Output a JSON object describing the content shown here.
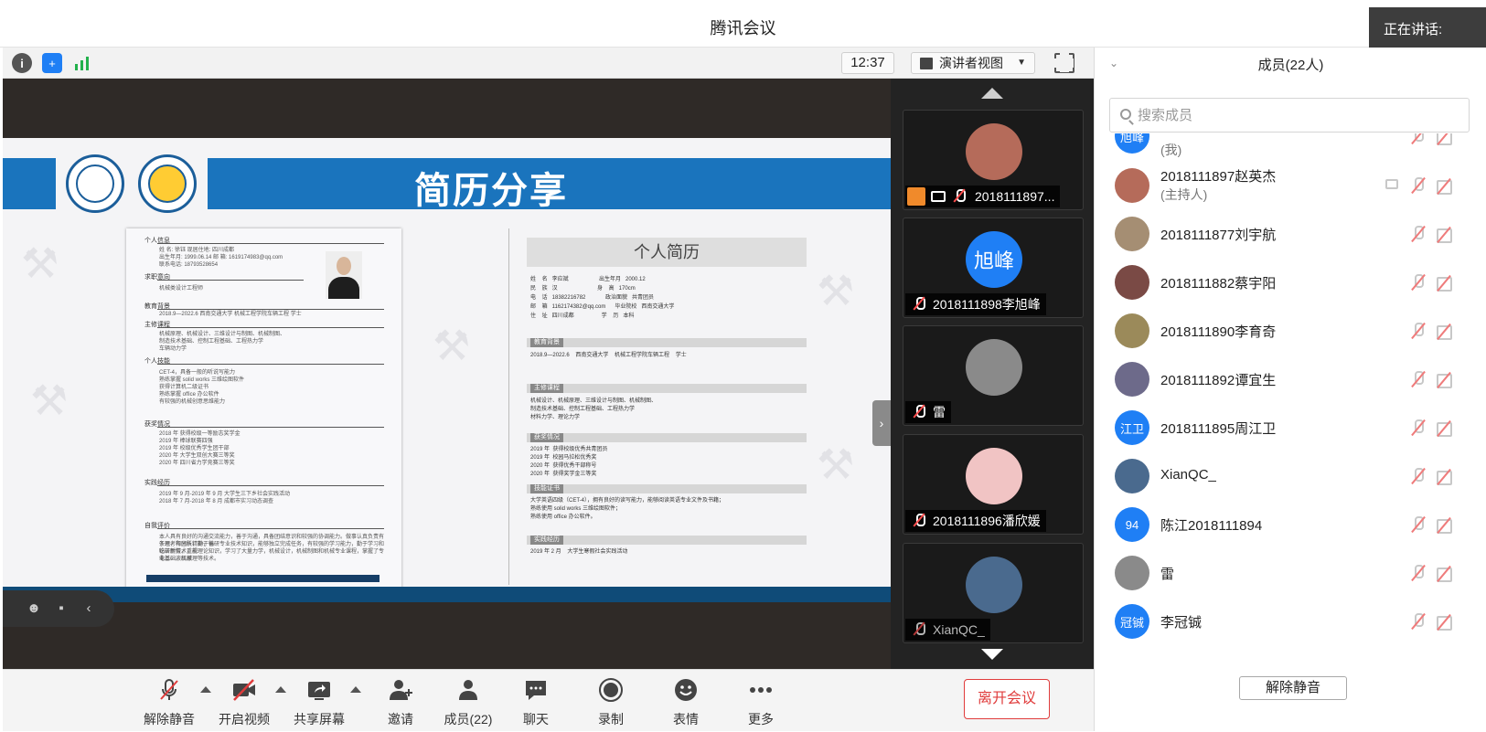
{
  "window": {
    "title": "腾讯会议",
    "speaking_label": "正在讲话:"
  },
  "toolbar": {
    "clock": "12:37",
    "view_mode": "演讲者视图"
  },
  "slide": {
    "banner_title": "简历分享",
    "resume_left": {
      "sections": [
        "个人信息",
        "求职意向",
        "教育背景",
        "主修课程",
        "个人技能",
        "获奖情况",
        "实践经历",
        "自我评价"
      ],
      "info_lines": [
        "姓 名: 徐钰 现居住地: 四川成都",
        "出生年月: 1999.06.14 邮 箱: 1619174983@qq.com",
        "联系电话: 18793528654"
      ],
      "intent": "机械类设计工程师",
      "education": "2018.9—2022.6 西南交通大学 机械工程学院车辆工程 学士",
      "courses": [
        "机械原理、机械设计、三维设计与制图、机械制图、",
        "制造技术基础、控制工程基础、工程热力学",
        "车辆动力学"
      ],
      "skills": [
        "CET-4，具备一般的听说写能力",
        "熟练掌握 solid works 三维绘图软件",
        "获得计算机二级证书",
        "熟练掌握 office 办公软件",
        "有较强的机械创意思维能力"
      ],
      "awards": [
        "2018 年 获得校级一等励志奖学金",
        "2019 年 棒球联赛四强",
        "2019 年 校级优秀学生团干部",
        "2020 年 大学生双创大赛三等奖",
        "2020 年 四川省力学竞赛三等奖"
      ],
      "practice": [
        "2019 年 9 月-2019 年 9 月 大学生三下乡社会实践活动",
        "2018 年 7 月-2018 年 8 月 成都市实习动态调查"
      ],
      "self_eval": [
        "本人具有良好的沟通交流能力，善于沟通，具备团结意识和较强的协调能力。做事认真负责有条理，有团队精神，善",
        "于思考和分析，勤于钻研专业技术知识，能够独立完成任务，有较强的学习能力，勤于学习和钻研新技术，能",
        "吃苦耐劳，重视理论知识，学习了大量力学，机械设计，机械制图和机械专业课程，掌握了专业基础。机械",
        "电工、液压原理等技术。"
      ]
    },
    "resume_right": {
      "title": "个人简历",
      "basic": [
        "姓    名   李应斌                    出生年月   2000.12",
        "民    族   汉                          身    高   170cm",
        "电    话   18382216782             政治面貌   共青团员",
        "邮    箱   1162174382@qq.com      毕业院校   西南交通大学",
        "住    址   四川成都                  学    历   本科"
      ],
      "sections": [
        "教育背景",
        "主修课程",
        "获奖情况",
        "技能证书",
        "实践经历"
      ],
      "education": "2018.9—2022.6    西南交通大学    机械工程学院车辆工程    学士",
      "courses": [
        "机械设计、机械原理、三维设计与制图、机械制图、",
        "制造技术基础、控制工程基础、工程热力学",
        "材料力学、理论力学"
      ],
      "awards": [
        "2019 年  获得校级优秀共青团员",
        "2019 年  校园马拉松优秀奖",
        "2020 年  获得优秀干部称号",
        "2020 年  获得奖学金三等奖"
      ],
      "certs": [
        "大学英语四级（CET-4），拥有良好的读写能力，能够阅读英语专业文件及书籍；",
        "熟练使用 solid works 三维绘图软件；",
        "熟练使用 office 办公软件。"
      ],
      "practice": "2019 年 2 月    大学生寒假社会实践活动"
    }
  },
  "participants_strip": [
    {
      "name": "2018111897...",
      "avatar_text": ""
    },
    {
      "name": "2018111898李旭峰",
      "avatar_text": "旭峰"
    },
    {
      "name": "雷",
      "avatar_text": ""
    },
    {
      "name": "2018111896潘欣媛",
      "avatar_text": ""
    },
    {
      "name": "XianQC_",
      "avatar_text": ""
    }
  ],
  "controls": {
    "unmute": "解除静音",
    "start_video": "开启视频",
    "share_screen": "共享屏幕",
    "invite": "邀请",
    "members": "成员(22)",
    "chat": "聊天",
    "record": "录制",
    "reactions": "表情",
    "more": "更多",
    "leave": "离开会议"
  },
  "members_panel": {
    "title": "成员(22人)",
    "search_placeholder": "搜索成员",
    "unmute_all": "解除静音",
    "items": [
      {
        "name": "",
        "sub": "(我)",
        "avatar_text": "旭峰",
        "avatar_color": "#1f7ff5"
      },
      {
        "name": "2018111897赵英杰",
        "sub": "(主持人)",
        "avatar_text": "",
        "avatar_color": "#b56b5a"
      },
      {
        "name": "2018111877刘宇航",
        "sub": "",
        "avatar_text": "",
        "avatar_color": "#a58e73"
      },
      {
        "name": "2018111882蔡宇阳",
        "sub": "",
        "avatar_text": "",
        "avatar_color": "#7a4a45"
      },
      {
        "name": "2018111890李育奇",
        "sub": "",
        "avatar_text": "",
        "avatar_color": "#9b8a5a"
      },
      {
        "name": "2018111892谭宜生",
        "sub": "",
        "avatar_text": "",
        "avatar_color": "#6d6a8a"
      },
      {
        "name": "2018111895周江卫",
        "sub": "",
        "avatar_text": "江卫",
        "avatar_color": "#1f7ff5"
      },
      {
        "name": "XianQC_",
        "sub": "",
        "avatar_text": "",
        "avatar_color": "#4a6a8e"
      },
      {
        "name": "陈江2018111894",
        "sub": "",
        "avatar_text": "94",
        "avatar_color": "#1f7ff5"
      },
      {
        "name": "雷",
        "sub": "",
        "avatar_text": "",
        "avatar_color": "#8a8a8a"
      },
      {
        "name": "李冠铖",
        "sub": "",
        "avatar_text": "冠铖",
        "avatar_color": "#1f7ff5"
      }
    ]
  },
  "colors": {
    "accent": "#1f7ff5",
    "leave": "#e03c3c",
    "banner": "#1a74bd"
  }
}
